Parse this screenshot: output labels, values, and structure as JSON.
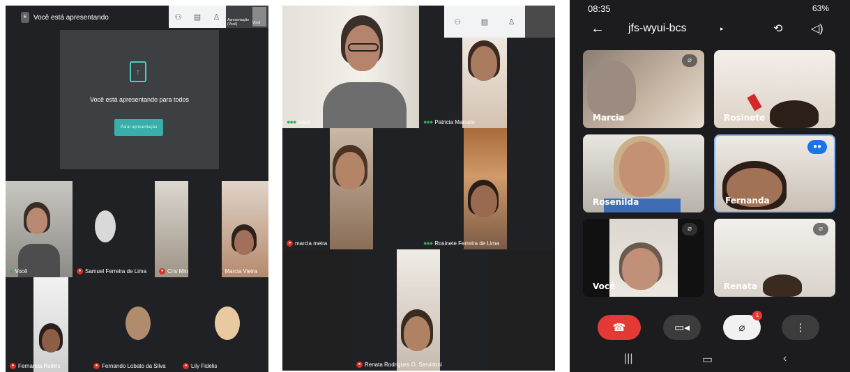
{
  "meet_desktop_presenting": {
    "header_title": "Você está apresentando",
    "avatar_letter": "E",
    "toolbar_mini_label": "Apresentação (Você)",
    "toolbar_mini_name": "Você",
    "presenting_message": "Você está apresentando para todos",
    "stop_button": "Parar apresentação",
    "participants": [
      {
        "name": "Você"
      },
      {
        "name": "Samuel Ferreira de Lima"
      },
      {
        "name": "Cris Miranda"
      },
      {
        "name": "Marcia Vieira"
      },
      {
        "name": "Fernanda Rollins"
      },
      {
        "name": "Fernando Lobato da Silva"
      },
      {
        "name": "Lily Fidelis"
      }
    ]
  },
  "meet_desktop_grid": {
    "participants": [
      {
        "name": "Você"
      },
      {
        "name": "Patricia Marcelo"
      },
      {
        "name": "marcia meira"
      },
      {
        "name": "Rosinete Ferreira de Lima"
      },
      {
        "name": "Renata Rodrigues G. Servidoni"
      }
    ]
  },
  "meet_mobile": {
    "status": {
      "time": "08:35",
      "battery": "63%"
    },
    "meeting_code": "jfs-wyui-bcs",
    "mic_badge": "1",
    "participants": [
      {
        "name": "Marcia"
      },
      {
        "name": "Rosinete"
      },
      {
        "name": "Rosenilda"
      },
      {
        "name": "Fernanda"
      },
      {
        "name": "Você"
      },
      {
        "name": "Renata"
      }
    ]
  },
  "colors": {
    "accent": "#3aafa9",
    "end_call": "#e53935",
    "speaking": "#1a73e8"
  }
}
